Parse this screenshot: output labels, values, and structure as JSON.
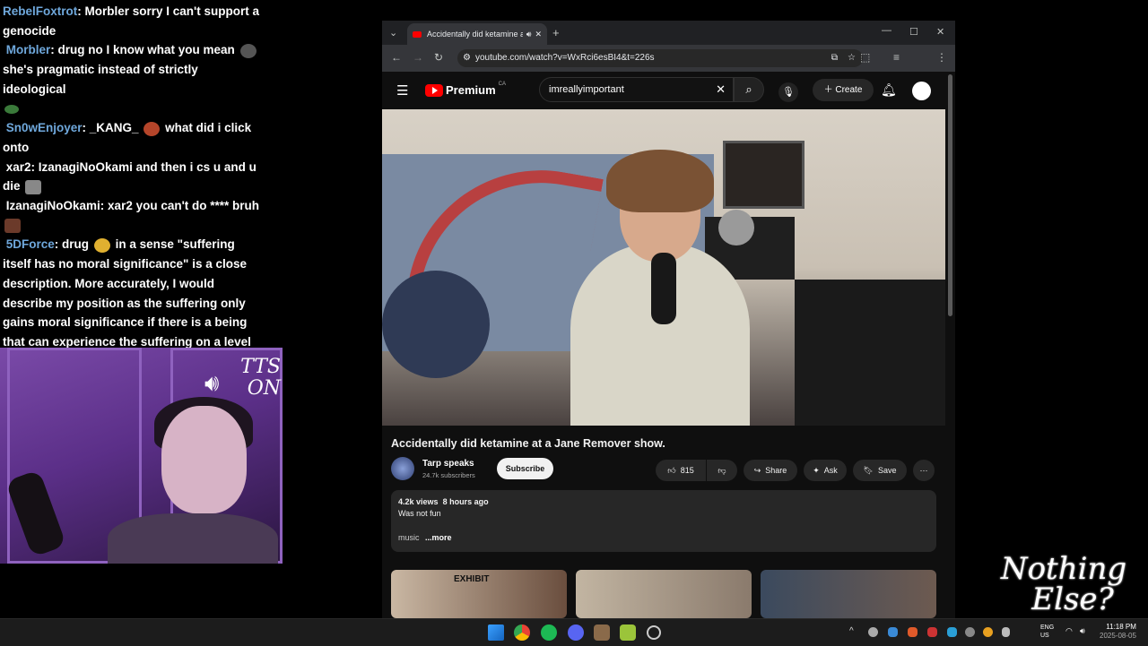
{
  "chat": {
    "messages": [
      {
        "user": "RebelFoxtrot",
        "text": "Morbler sorry I can't support a genocide"
      },
      {
        "user": "Morbler",
        "text": "drug no I know what you mean",
        "text2": "she's pragmatic instead of strictly ideological"
      },
      {
        "user": "Sn0wEnjoyer",
        "text": "_KANG_",
        "text2": "what did i click onto"
      },
      {
        "user": "xar2",
        "text": "IzanagiNoOkami and then i cs u and u die"
      },
      {
        "user": "IzanagiNoOkami",
        "text": "xar2 you can't do **** bruh"
      },
      {
        "user": "5DForce",
        "text": "drug",
        "text2": "in a sense \"suffering itself has no moral significance\" is a close description. More accurately, I would describe my position as the suffering only gains moral significance if there is a being that can experience the suffering on a level that is \"sentient\" enough."
      }
    ]
  },
  "overlay": {
    "tts_line1": "TTS",
    "tts_line2": "ON",
    "logo_line1": "Nothing",
    "logo_line2": "Else?"
  },
  "browser": {
    "tab_title": "Accidentally did ketamine a",
    "url": "youtube.com/watch?v=WxRci6esBI4&t=226s"
  },
  "youtube": {
    "brand": "Premium",
    "region": "CA",
    "search_value": "imreallyimportant",
    "create_label": "Create",
    "video_title": "Accidentally did ketamine at a Jane Remover show.",
    "channel_name": "Tarp speaks",
    "subscribers": "24.7k subscribers",
    "subscribe_label": "Subscribe",
    "likes": "815",
    "share_label": "Share",
    "ask_label": "Ask",
    "save_label": "Save",
    "views": "4.2k views",
    "age": "8 hours ago",
    "description": "Was not fun",
    "desc_music": "music",
    "more_label": "...more",
    "thumb1_text": "EXHIBIT"
  },
  "taskbar": {
    "lang1": "ENG",
    "lang2": "US",
    "time": "11:18 PM",
    "date": "2025-08-05"
  }
}
